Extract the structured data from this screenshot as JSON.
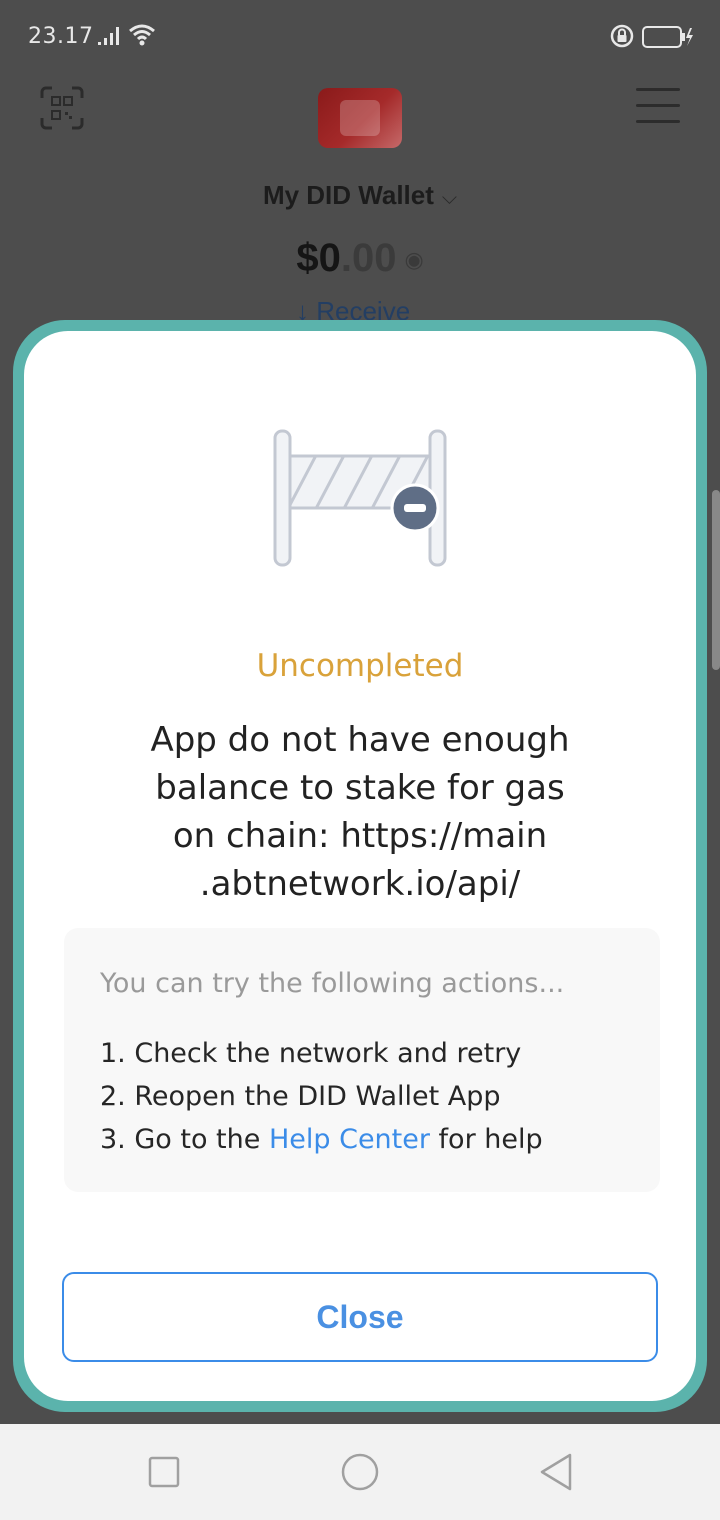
{
  "status_bar": {
    "time": "23.17",
    "icons": [
      "signal-icon",
      "wifi-icon",
      "lock-rotation-icon",
      "battery-charging-icon"
    ]
  },
  "app": {
    "wallet_name": "My DID Wallet",
    "balance_whole": "$0",
    "balance_cents": ".00",
    "receive_label": "↓ Receive"
  },
  "modal": {
    "status": "Uncompleted",
    "message_lines": [
      "App do not have enough",
      "balance to stake for gas",
      "on chain: https://main",
      ".abtnetwork.io/api/"
    ],
    "hint_heading": "You can try the following actions...",
    "hints": {
      "h1": "1. Check the network and retry",
      "h2": "2. Reopen the DID Wallet App",
      "h3_prefix": "3. Go to the ",
      "h3_link": "Help Center",
      "h3_suffix": " for help"
    },
    "close_label": "Close"
  },
  "colors": {
    "status_title": "#d9a23a",
    "link": "#3b8ce8",
    "sheet_border": "#5bb3ac",
    "dim_background": "#4d4d4d"
  }
}
